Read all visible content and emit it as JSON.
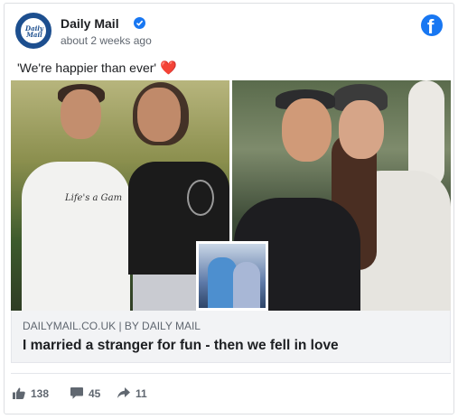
{
  "post": {
    "page_name": "Daily Mail",
    "logo_text_line1": "Daily",
    "logo_text_line2": "Mail",
    "timestamp": "about 2 weeks ago",
    "text": "'We're happier than ever'",
    "emoji": "❤️"
  },
  "media": {
    "shirt_text": "Life's a Gam"
  },
  "link": {
    "domain": "DAILYMAIL.CO.UK | BY DAILY MAIL",
    "title": "I married a stranger for fun - then we fell in love"
  },
  "stats": {
    "likes": "138",
    "comments": "45",
    "shares": "11"
  },
  "icons": {
    "verified": "verified-badge-icon",
    "facebook": "facebook-icon",
    "like": "like-icon",
    "comment": "comment-icon",
    "share": "share-icon"
  },
  "colors": {
    "accent": "#1877f2",
    "brand_dailymail": "#1d4f8f",
    "heart": "#e0245e"
  }
}
